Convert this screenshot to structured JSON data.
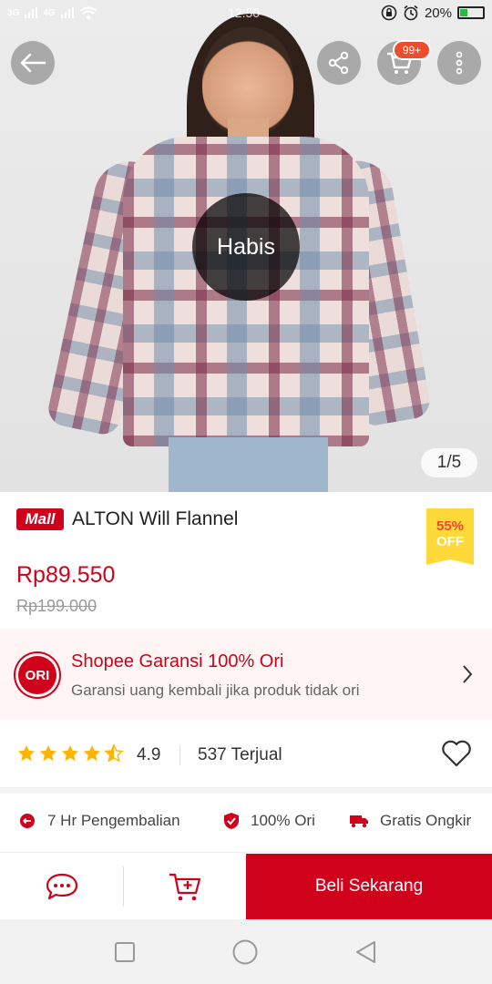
{
  "status_bar": {
    "network_1": "3G",
    "network_2": "4G",
    "time": "12:50",
    "battery": "20%"
  },
  "hero": {
    "overlay_label": "Habis",
    "image_counter": "1/5",
    "cart_count": "99+"
  },
  "product": {
    "mall_label": "Mall",
    "title": "ALTON Will Flannel",
    "discount_pct": "55%",
    "discount_off": "OFF",
    "price": "Rp89.550",
    "original_price": "Rp199.000"
  },
  "guarantee": {
    "badge": "ORI",
    "title": "Shopee Garansi 100% Ori",
    "subtitle": "Garansi uang kembali jika produk tidak ori"
  },
  "rating": {
    "value": "4.9",
    "stars": 4.5,
    "sold": "537 Terjual"
  },
  "features": [
    {
      "label": "7 Hr Pengembalian",
      "icon": "return-icon"
    },
    {
      "label": "100% Ori",
      "icon": "shield-check-icon"
    },
    {
      "label": "Gratis Ongkir",
      "icon": "truck-icon"
    }
  ],
  "actions": {
    "buy_label": "Beli Sekarang"
  },
  "colors": {
    "brand_red": "#d0011b",
    "shopee_orange": "#ee4d2d",
    "discount_yellow": "#ffd839"
  }
}
